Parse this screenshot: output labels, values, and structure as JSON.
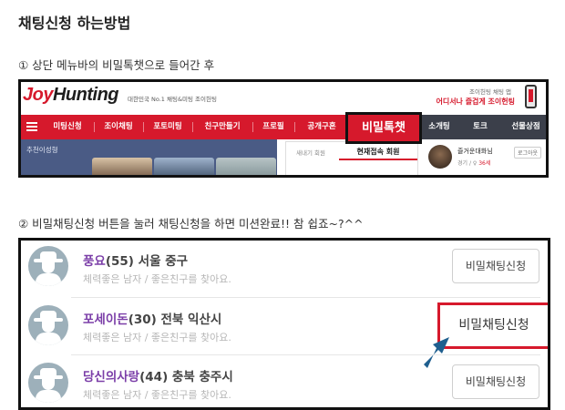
{
  "title": "채팅신청 하는방법",
  "steps": [
    "① 상단 메뉴바의 비밀톡챗으로 들어간 후",
    "② 비밀채팅신청 버튼을 눌러 채팅신청을 하면 미션완료!! 참 쉽죠~?^^"
  ],
  "screenshot1": {
    "logo_first": "Joy",
    "logo_second": "Hunting",
    "tagline": "대한민국 No.1 채팅&미팅 조이헌팅",
    "ad_small": "조이헌팅 채팅 앱",
    "ad_big": "어디서나 즐겁게 조이헌팅",
    "nav": [
      "미팅신청",
      "조이채팅",
      "포토미팅",
      "친구만들기",
      "프로필",
      "공개구혼",
      "비밀톡챗",
      "소개팅",
      "토크",
      "선물상점"
    ],
    "highlighted_nav": "비밀톡챗",
    "recommend_label": "추천이성형",
    "tab_new": "새내기 회원",
    "tab_current": "현재접속 회원",
    "profile_name": "즐거운대화님",
    "profile_meta_prefix": "경기 / ♀",
    "profile_meta_value": "36세",
    "logout": "로그아웃",
    "colors": {
      "brand_red": "#d6192c",
      "nav_dark": "#3b3f4a",
      "recommend_bg": "#4a5b85"
    }
  },
  "screenshot2": {
    "members": [
      {
        "nickname": "풍요",
        "details": "(55) 서울 중구",
        "message": "체력좋은 남자 / 좋은친구를 찾아요."
      },
      {
        "nickname": "포세이돈",
        "details": "(30) 전북 익산시",
        "message": "체력좋은 남자 / 좋은친구를 찾아요."
      },
      {
        "nickname": "당신의사랑",
        "details": "(44) 충북 충주시",
        "message": "체력좋은 남자 / 좋은친구를 찾아요."
      }
    ],
    "apply_label": "비밀채팅신청",
    "colors": {
      "nickname": "#7b3ea8",
      "highlight_border": "#d6192c",
      "arrow": "#1f5f8f"
    }
  }
}
